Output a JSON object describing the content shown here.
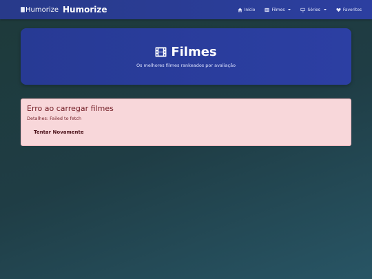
{
  "navbar": {
    "logo_alt": "Humorize",
    "brand_name": "Humorize",
    "links": [
      {
        "label": "Início",
        "icon": "home-icon",
        "dropdown": false
      },
      {
        "label": "Filmes",
        "icon": "film-icon",
        "dropdown": true
      },
      {
        "label": "Séries",
        "icon": "tv-icon",
        "dropdown": true
      },
      {
        "label": "Favoritos",
        "icon": "heart-icon",
        "dropdown": false
      }
    ]
  },
  "hero": {
    "icon": "film-icon",
    "title": "Filmes",
    "subtitle": "Os melhores filmes rankeados por avaliação"
  },
  "alert": {
    "title": "Erro ao carregar filmes",
    "detail": "Detalhes: Failed to fetch",
    "retry_label": "Tentar Novamente"
  },
  "colors": {
    "navbar": "#2c3fa0",
    "hero": "#2a3d9c",
    "alert_bg": "#f8d7da",
    "alert_text": "#721c24"
  }
}
